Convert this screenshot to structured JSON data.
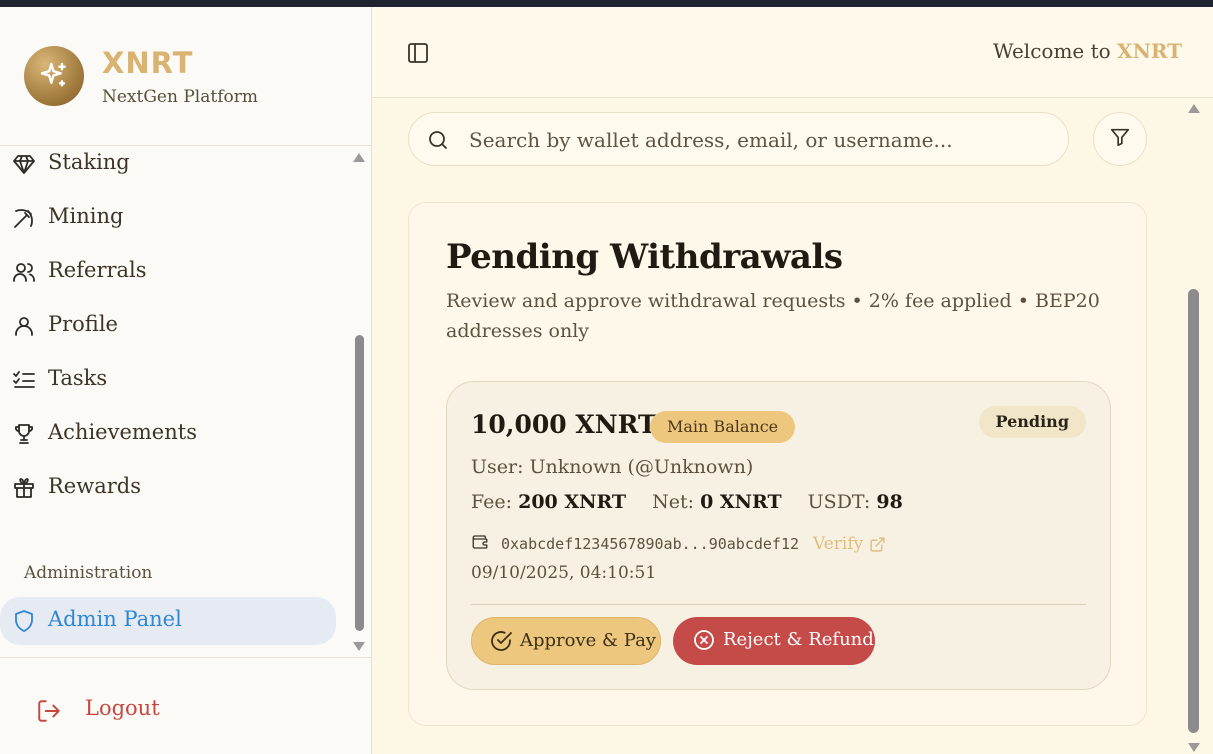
{
  "brand": {
    "title": "XNRT",
    "subtitle": "NextGen Platform"
  },
  "sidebar": {
    "items": [
      {
        "label": "Staking",
        "icon": "gem-icon"
      },
      {
        "label": "Mining",
        "icon": "pickaxe-icon"
      },
      {
        "label": "Referrals",
        "icon": "users-icon"
      },
      {
        "label": "Profile",
        "icon": "user-icon"
      },
      {
        "label": "Tasks",
        "icon": "list-checks-icon"
      },
      {
        "label": "Achievements",
        "icon": "trophy-icon"
      },
      {
        "label": "Rewards",
        "icon": "gift-icon"
      }
    ],
    "section_label": "Administration",
    "admin_label": "Admin Panel",
    "logout_label": "Logout"
  },
  "header": {
    "welcome_prefix": "Welcome to",
    "welcome_brand": "XNRT"
  },
  "search": {
    "placeholder": "Search by wallet address, email, or username..."
  },
  "panel": {
    "title": "Pending Withdrawals",
    "description": "Review and approve withdrawal requests • 2% fee applied • BEP20 addresses only"
  },
  "withdrawal": {
    "amount": "10,000 XNRT",
    "source_badge": "Main Balance",
    "status": "Pending",
    "user": "User: Unknown (@Unknown)",
    "fee_label": "Fee:",
    "fee_value": "200 XNRT",
    "net_label": "Net:",
    "net_value": "0 XNRT",
    "usdt_label": "USDT:",
    "usdt_value": "98",
    "address": "0xabcdef1234567890ab...90abcdef12",
    "verify_label": "Verify",
    "date": "09/10/2025, 04:10:51",
    "approve_label": "Approve & Pay",
    "reject_label": "Reject & Refund"
  },
  "colors": {
    "accent_gold": "#eec77f",
    "brand_gold": "#d8b372",
    "danger": "#c54b49",
    "active_blue": "#2f87d4"
  }
}
